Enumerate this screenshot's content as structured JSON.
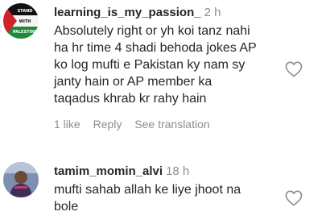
{
  "comments": [
    {
      "avatar": {
        "icon": "palestine-flag-avatar-icon",
        "lines": [
          "STAND",
          "WITH",
          "PALESTINE"
        ],
        "colors": {
          "top": "#111111",
          "middle": "#f5f5f5",
          "bottom": "#1f8a3a",
          "triangle": "#d0222b"
        }
      },
      "username": "learning_is_my_passion_",
      "time": "2 h",
      "text": "Absolutely right or yh koi tanz nahi\nha hr time 4 shadi behoda jokes AP\nko log mufti e Pakistan ky nam sy\njanty hain or AP member ka\ntaqadus khrab kr rahy hain",
      "likes_label": "1 like",
      "reply_label": "Reply",
      "translation_label": "See translation",
      "like_icon": "heart-outline-icon"
    },
    {
      "avatar": {
        "icon": "profile-photo-avatar-icon"
      },
      "username": "tamim_momin_alvi",
      "time": "18 h",
      "text": "mufti sahab allah ke liye jhoot na\nbole",
      "like_icon": "heart-outline-icon"
    }
  ]
}
